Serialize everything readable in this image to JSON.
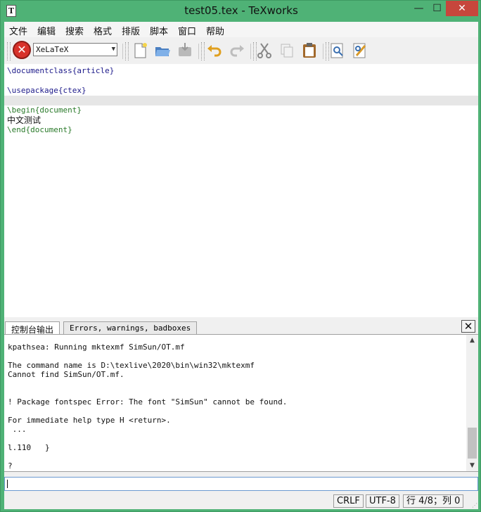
{
  "window": {
    "title": "test05.tex - TeXworks",
    "app_icon_glyph": "T"
  },
  "window_controls": {
    "minimize": "—",
    "maximize": "☐",
    "close": "✕"
  },
  "menu": [
    "文件",
    "编辑",
    "搜索",
    "格式",
    "排版",
    "脚本",
    "窗口",
    "帮助"
  ],
  "toolbar": {
    "engine": "XeLaTeX",
    "run_glyph": "✕",
    "icons": [
      "new-document-icon",
      "open-folder-icon",
      "save-icon",
      "undo-icon",
      "redo-icon",
      "cut-icon",
      "copy-icon",
      "paste-icon",
      "find-icon",
      "replace-icon"
    ]
  },
  "editor": {
    "lines": [
      {
        "cmd": "\\documentclass",
        "arg": "{article}"
      },
      {
        "cmd": "",
        "arg": ""
      },
      {
        "cmd": "\\usepackage",
        "arg": "{ctex}"
      },
      {
        "cmd": "",
        "arg": ""
      },
      {
        "cmd": "\\begin",
        "arg": "{document}"
      },
      {
        "text": "中文测试"
      },
      {
        "cmd": "\\end",
        "arg": "{document}"
      }
    ]
  },
  "console": {
    "tabs": [
      "控制台输出",
      "Errors, warnings, badboxes"
    ],
    "close_glyph": "✕",
    "lines": [
      "kpathsea: Running mktexmf SimSun/OT.mf",
      "",
      "The command name is D:\\texlive\\2020\\bin\\win32\\mktexmf",
      "Cannot find SimSun/OT.mf.",
      "",
      "",
      "! Package fontspec Error: The font \"SimSun\" cannot be found.",
      "",
      "For immediate help type H <return>.",
      " ...",
      "",
      "l.110   }",
      "",
      "?"
    ]
  },
  "status": {
    "eol": "CRLF",
    "encoding": "UTF-8",
    "position": "行 4/8；列 0"
  },
  "colors": {
    "frame": "#4fb276",
    "close": "#c7463c",
    "run": "#d8322b",
    "code": "#1d1a8a"
  }
}
